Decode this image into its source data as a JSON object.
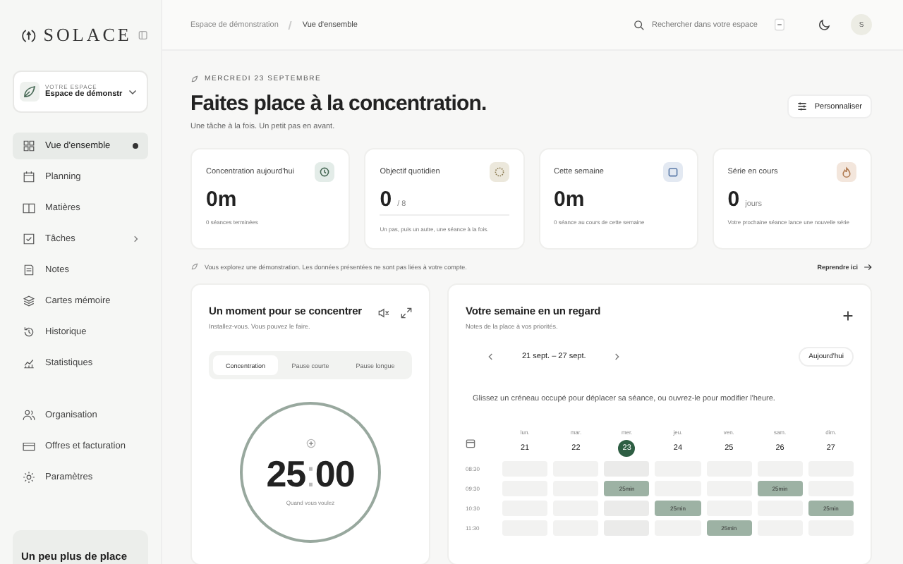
{
  "sidebar": {
    "brand": "SOLACE",
    "workspace": {
      "caption": "VOTRE ESPACE",
      "name": "Espace de démonstr"
    },
    "nav": [
      {
        "label": "Vue d'ensemble",
        "selected": true,
        "expandable": false
      },
      {
        "label": "Planning",
        "selected": false,
        "expandable": false
      },
      {
        "label": "Matières",
        "selected": false,
        "expandable": false
      },
      {
        "label": "Tâches",
        "selected": false,
        "expandable": true
      },
      {
        "label": "Notes",
        "selected": false,
        "expandable": false
      },
      {
        "label": "Cartes mémoire",
        "selected": false,
        "expandable": false
      },
      {
        "label": "Historique",
        "selected": false,
        "expandable": false
      },
      {
        "label": "Statistiques",
        "selected": false,
        "expandable": false
      }
    ],
    "secondary": [
      {
        "label": "Organisation"
      },
      {
        "label": "Offres et facturation"
      },
      {
        "label": "Paramètres"
      }
    ],
    "promo": {
      "title": "Un peu plus de place"
    }
  },
  "header": {
    "breadcrumb": [
      "Espace de démonstration",
      "Vue d'ensemble"
    ],
    "search": {
      "placeholder": "Rechercher dans votre espace"
    },
    "avatar": "S"
  },
  "page": {
    "date": "MERCREDI 23 SEPTEMBRE",
    "title": "Faites place à la concentration.",
    "subtitle": "Une tâche à la fois. Un petit pas en avant.",
    "customize_button": "Personnaliser"
  },
  "stats": [
    {
      "label": "Concentration aujourd'hui",
      "value": "0m",
      "note": "0 séances terminées",
      "color": "#e3ece8"
    },
    {
      "label": "Objectif quotidien",
      "value": "0",
      "unit": "/ 8",
      "note": "Un pas, puis un autre, une séance à la fois.",
      "color": "#ece8dc"
    },
    {
      "label": "Cette semaine",
      "value": "0m",
      "note": "0 séance au cours de cette semaine",
      "color": "#e3e9f2"
    },
    {
      "label": "Série en cours",
      "value": "0",
      "unit": "jours",
      "note": "Votre prochaine séance lance une nouvelle série",
      "color": "#f3e6dc"
    }
  ],
  "notice": {
    "text": "Vous explorez une démonstration. Les données présentées ne sont pas liées à votre compte.",
    "link": "Reprendre ici"
  },
  "focus": {
    "title": "Un moment pour se concentrer",
    "subtitle": "Installez-vous. Vous pouvez le faire.",
    "modes": [
      {
        "label": "Concentration",
        "selected": true
      },
      {
        "label": "Pause courte",
        "selected": false
      },
      {
        "label": "Pause longue",
        "selected": false
      }
    ],
    "timer": {
      "minutes": "25",
      "separator": ":",
      "seconds": "00",
      "caption": "Quand vous voulez"
    }
  },
  "week": {
    "title": "Votre semaine en un regard",
    "subtitle": "Notes de la place à vos priorités.",
    "range": "21 sept. – 27 sept.",
    "today_button": "Aujourd'hui",
    "hint": "Glissez un créneau occupé pour déplacer sa séance, ou ouvrez-le pour modifier l'heure.",
    "days": [
      {
        "name": "lun.",
        "date": "21",
        "selected": false
      },
      {
        "name": "mar.",
        "date": "22",
        "selected": false
      },
      {
        "name": "mer.",
        "date": "23",
        "selected": true
      },
      {
        "name": "jeu.",
        "date": "24",
        "selected": false
      },
      {
        "name": "ven.",
        "date": "25",
        "selected": false
      },
      {
        "name": "sam.",
        "date": "26",
        "selected": false
      },
      {
        "name": "dim.",
        "date": "27",
        "selected": false
      }
    ],
    "rows": [
      {
        "time": "08:30",
        "slots": [
          {
            "busy": false
          },
          {
            "busy": false
          },
          {
            "busy": false
          },
          {
            "busy": false
          },
          {
            "busy": false
          },
          {
            "busy": false
          },
          {
            "busy": false
          }
        ]
      },
      {
        "time": "09:30",
        "slots": [
          {
            "busy": false
          },
          {
            "busy": false
          },
          {
            "busy": true,
            "label": "25min"
          },
          {
            "busy": false
          },
          {
            "busy": false
          },
          {
            "busy": true,
            "label": "25min"
          },
          {
            "busy": false
          }
        ]
      },
      {
        "time": "10:30",
        "slots": [
          {
            "busy": false
          },
          {
            "busy": false
          },
          {
            "busy": false
          },
          {
            "busy": true,
            "label": "25min"
          },
          {
            "busy": false
          },
          {
            "busy": false
          },
          {
            "busy": true,
            "label": "25min"
          }
        ]
      },
      {
        "time": "11:30",
        "slots": [
          {
            "busy": false
          },
          {
            "busy": false
          },
          {
            "busy": false
          },
          {
            "busy": false
          },
          {
            "busy": true,
            "label": "25min"
          },
          {
            "busy": false
          },
          {
            "busy": false
          }
        ]
      }
    ]
  }
}
